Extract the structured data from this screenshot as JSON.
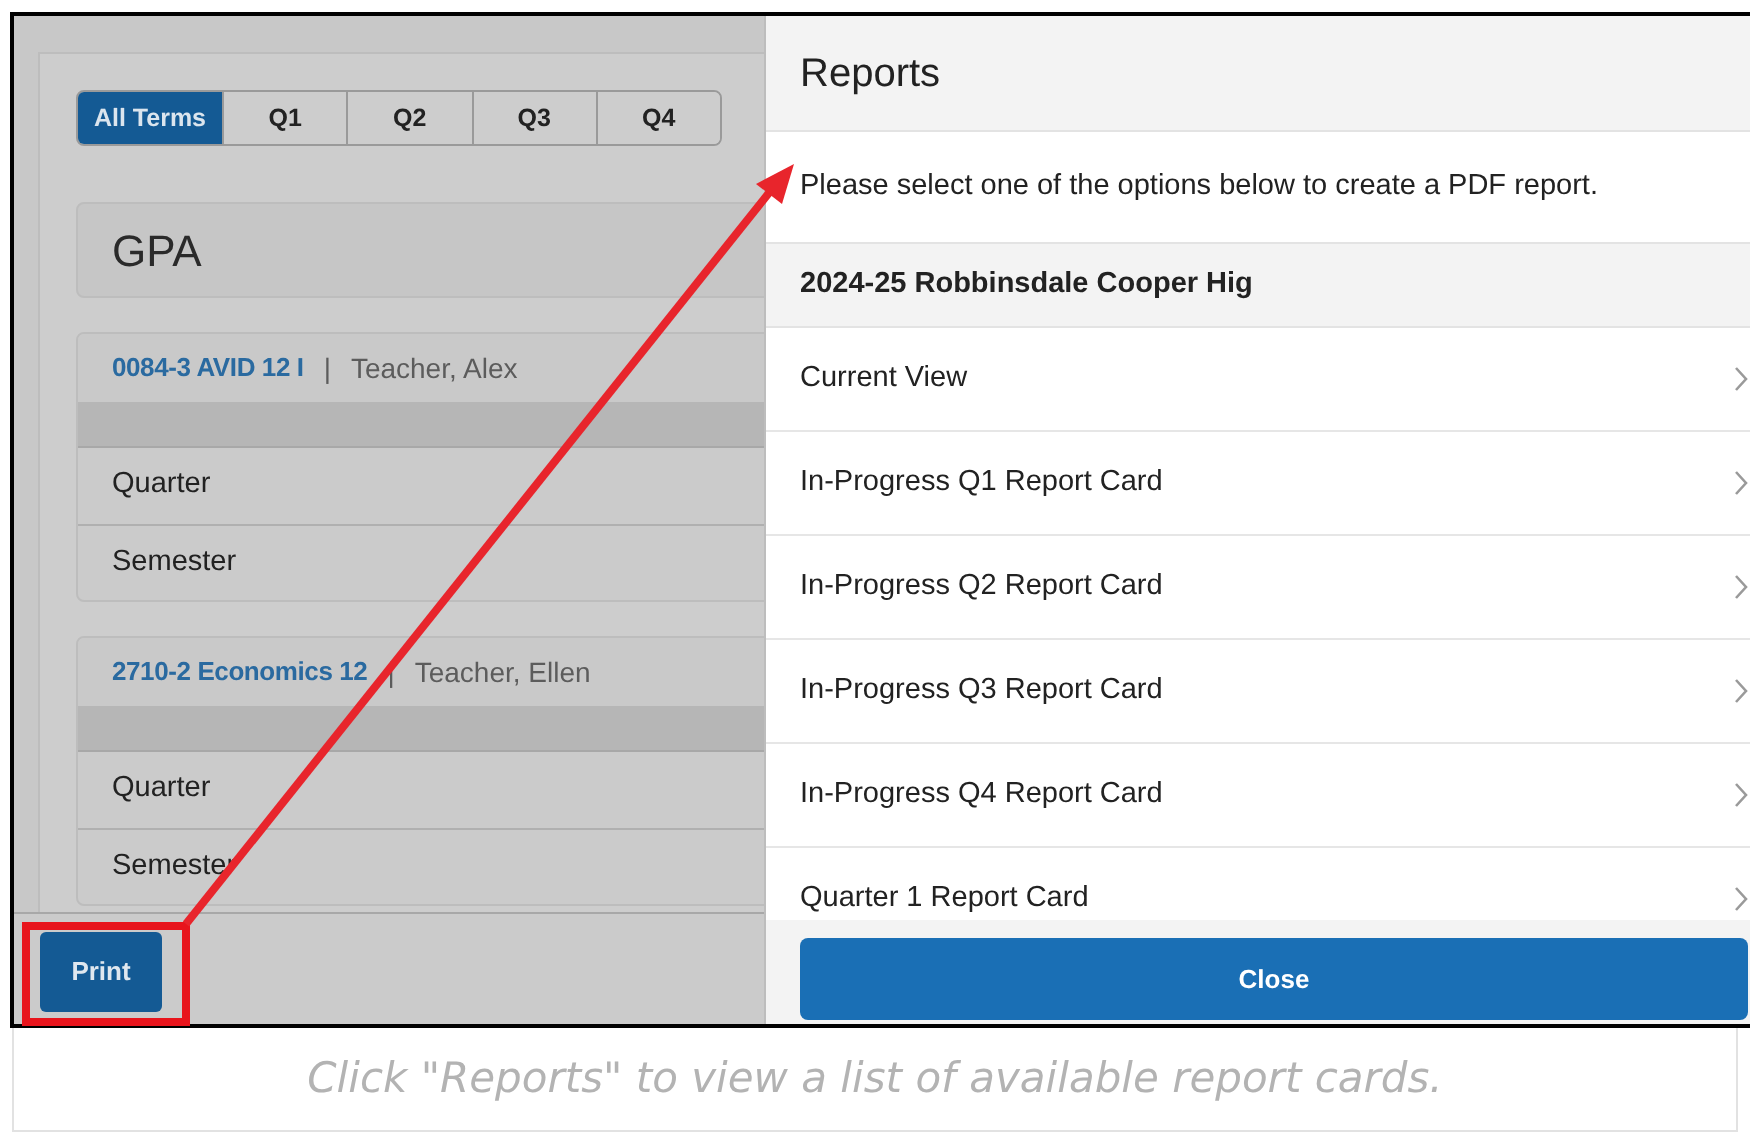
{
  "term_tabs": [
    {
      "label": "All Terms",
      "selected": true
    },
    {
      "label": "Q1",
      "selected": false
    },
    {
      "label": "Q2",
      "selected": false
    },
    {
      "label": "Q3",
      "selected": false
    },
    {
      "label": "Q4",
      "selected": false
    }
  ],
  "gpa_title": "GPA",
  "courses": [
    {
      "name": "0084-3 AVID 12 I",
      "separator": "|",
      "teacher": "Teacher, Alex",
      "rows": [
        "Quarter",
        "Semester"
      ]
    },
    {
      "name": "2710-2 Economics 12",
      "separator": "|",
      "teacher": "Teacher, Ellen",
      "rows": [
        "Quarter",
        "Semester"
      ]
    }
  ],
  "print_button": "Print",
  "reports_panel": {
    "title": "Reports",
    "instruction": "Please select one of the options below to create a PDF report.",
    "school": "2024-25 Robbinsdale Cooper Hig",
    "options": [
      "Current View",
      "In-Progress Q1 Report Card",
      "In-Progress Q2 Report Card",
      "In-Progress Q3 Report Card",
      "In-Progress Q4 Report Card",
      "Quarter 1 Report Card"
    ],
    "close_button": "Close"
  },
  "caption": "Click \"Reports\" to view a list of available report cards."
}
